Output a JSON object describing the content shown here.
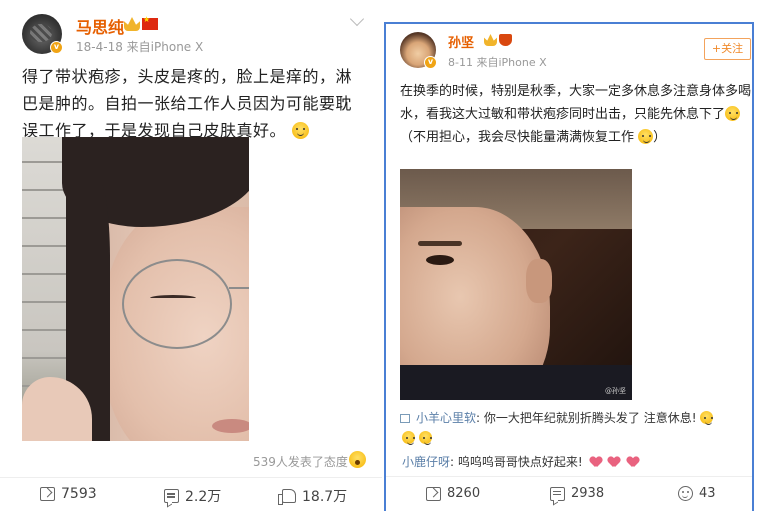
{
  "left_post": {
    "username": "马思纯",
    "date": "18-4-18",
    "source": "来自iPhone X",
    "text": "得了带状疱疹，头皮是疼的，脸上是痒的，淋巴是肿的。自拍一张给工作人员因为可能要耽误工作了，于是发现自己皮肤真好。",
    "reaction_summary": "539人发表了态度",
    "reposts": "7593",
    "comments": "2.2万",
    "likes": "18.7万"
  },
  "right_post": {
    "username": "孙坚",
    "date": "8-11",
    "source": "来自iPhone X",
    "follow_label": "+关注",
    "text_1": "在换季的时候，特别是秋季，大家一定多休息多注意身体多喝水，看我这大过敏和带状疱疹同时出击，只能先休息下了",
    "text_2": "（不用担心，我会尽快能量满满恢复工作",
    "text_3": "）",
    "photo_watermark": "@孙坚",
    "comments_preview": [
      {
        "author": "小羊心里软",
        "text": ": 你一大把年纪就别折腾头发了 注意休息!"
      },
      {
        "author": "小鹿仔呀",
        "text": ": 呜呜呜哥哥快点好起来!"
      }
    ],
    "reposts": "8260",
    "comments": "2938",
    "likes": "43"
  },
  "colors": {
    "username": "#e65f00",
    "highlight_border": "#4a7fd4",
    "commenter": "#5b7fa8"
  },
  "icons": [
    "verified-badge-icon",
    "crown-icon",
    "flag-icon",
    "chevron-down-icon",
    "repost-icon",
    "comment-icon",
    "like-icon",
    "smile-icon",
    "heart-icon"
  ]
}
